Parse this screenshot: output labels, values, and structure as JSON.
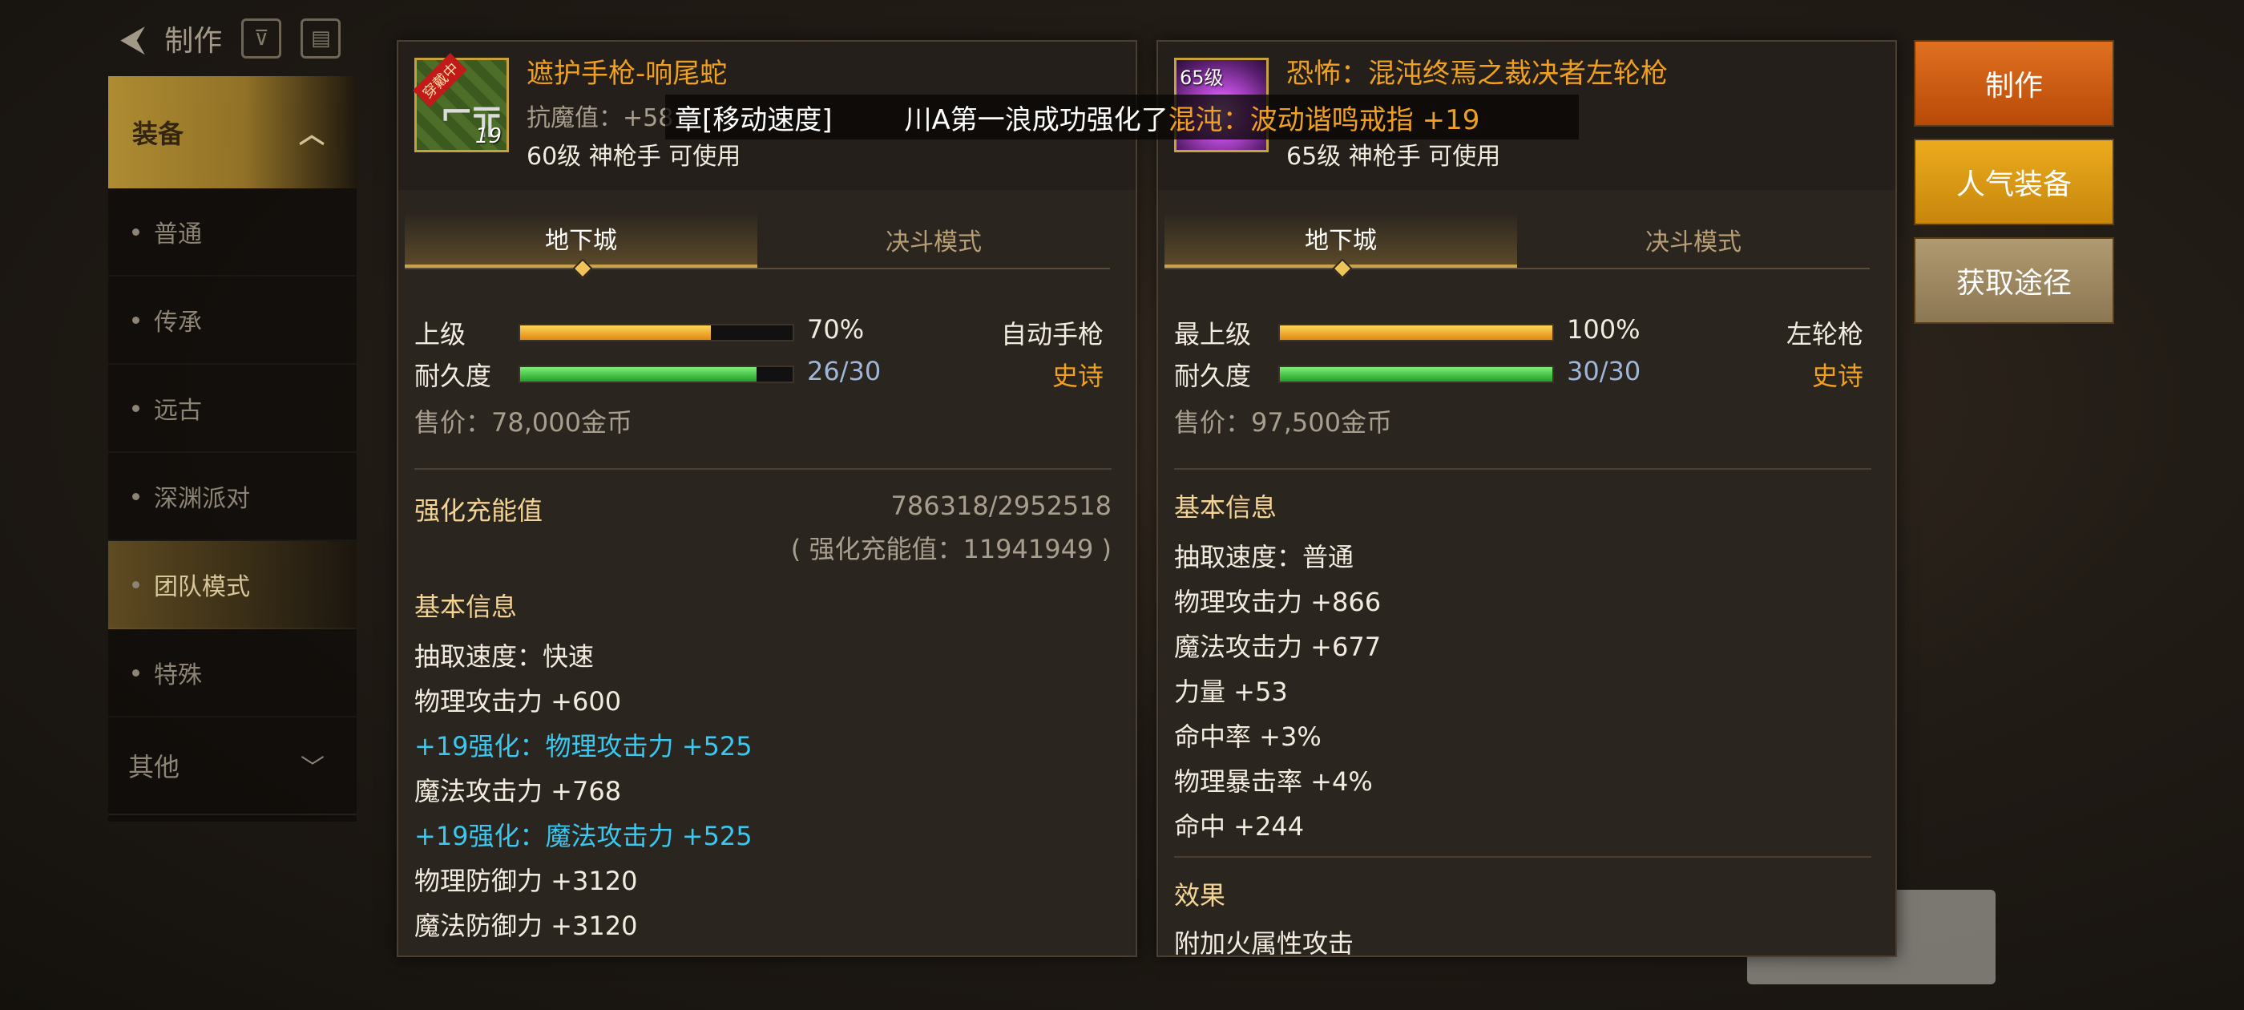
{
  "topnav": {
    "title": "制作"
  },
  "sidebar": {
    "category": "装备",
    "items": [
      "普通",
      "传承",
      "远古",
      "深渊派对",
      "团队模式",
      "特殊"
    ],
    "other": "其他"
  },
  "notice": {
    "part1": "章[移动速度]",
    "part2": "川A第一浪成功强化了",
    "part3": "混沌：",
    "part4": "波动谐鸣戒指 +19"
  },
  "left_item": {
    "icon_tag": "穿戴中",
    "icon_level": "19",
    "name": "遮护手枪-响尾蛇",
    "sub1": "抗魔值：+58",
    "sub2": "60级 神枪手 可使用",
    "tabs": [
      "地下城",
      "决斗模式"
    ],
    "grade_label": "上级",
    "grade_percent": 70,
    "grade_value": "70%",
    "durability_label": "耐久度",
    "durability_fraction": 0.867,
    "durability_value": "26/30",
    "type": "自动手枪",
    "rarity": "史诗",
    "price": "售价：78,000金币",
    "charge_title": "强化充能值",
    "charge_value": "786318/2952518",
    "charge_sub": "( 强化充能值：11941949 )",
    "basic_title": "基本信息",
    "stats": [
      {
        "text": "抽取速度：快速",
        "color": "white"
      },
      {
        "text": "物理攻击力 +600",
        "color": "white"
      },
      {
        "text": "+19强化：物理攻击力 +525",
        "color": "cyan"
      },
      {
        "text": "魔法攻击力 +768",
        "color": "white"
      },
      {
        "text": "+19强化：魔法攻击力 +525",
        "color": "cyan"
      },
      {
        "text": "物理防御力 +3120",
        "color": "white"
      },
      {
        "text": "魔法防御力 +3120",
        "color": "white"
      }
    ]
  },
  "right_item": {
    "icon_badge": "65级",
    "name": "恐怖：混沌终焉之裁决者左轮枪",
    "sub2": "65级 神枪手 可使用",
    "tabs": [
      "地下城",
      "决斗模式"
    ],
    "grade_label": "最上级",
    "grade_percent": 100,
    "grade_value": "100%",
    "durability_label": "耐久度",
    "durability_fraction": 1.0,
    "durability_value": "30/30",
    "type": "左轮枪",
    "rarity": "史诗",
    "price": "售价：97,500金币",
    "basic_title": "基本信息",
    "stats": [
      {
        "text": "抽取速度：普通",
        "color": "white"
      },
      {
        "text": "物理攻击力 +866",
        "color": "white"
      },
      {
        "text": "魔法攻击力 +677",
        "color": "white"
      },
      {
        "text": "力量 +53",
        "color": "white"
      },
      {
        "text": "命中率 +3%",
        "color": "white"
      },
      {
        "text": "物理暴击率 +4%",
        "color": "white"
      },
      {
        "text": "命中 +244",
        "color": "white"
      }
    ],
    "effect_title": "效果",
    "effect_partial": "附加火属性攻击"
  },
  "actions": {
    "make": "制作",
    "popular": "人气装备",
    "source": "获取途径"
  }
}
